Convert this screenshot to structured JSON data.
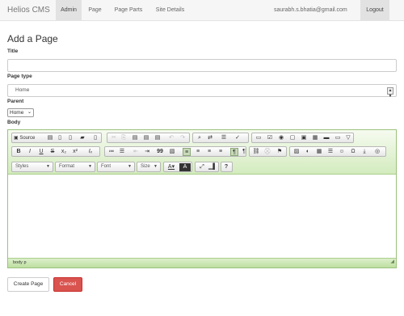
{
  "navbar": {
    "brand": "Helios CMS",
    "items": [
      {
        "label": "Admin",
        "active": true
      },
      {
        "label": "Page",
        "active": false
      },
      {
        "label": "Page Parts",
        "active": false
      },
      {
        "label": "Site Details",
        "active": false
      }
    ],
    "user_email": "saurabh.s.bhatia@gmail.com",
    "logout_label": "Logout"
  },
  "form": {
    "heading": "Add a Page",
    "title_label": "Title",
    "title_value": "",
    "page_type_label": "Page type",
    "page_type_value": "Home",
    "parent_label": "Parent",
    "parent_value": "Home",
    "body_label": "Body"
  },
  "editor": {
    "source_label": "Source",
    "toolbar_row1": [
      {
        "name": "save-icon",
        "glyph": "💾"
      },
      {
        "name": "new-page-icon",
        "glyph": "🗋"
      },
      {
        "name": "preview-icon",
        "glyph": "🗎"
      },
      {
        "name": "print-icon",
        "glyph": "🖶"
      },
      {
        "name": "templates-icon",
        "glyph": "🗐"
      },
      {
        "name": "cut-icon",
        "glyph": "✂"
      },
      {
        "name": "copy-icon",
        "glyph": "⎘"
      },
      {
        "name": "paste-icon",
        "glyph": "📋"
      },
      {
        "name": "paste-text-icon",
        "glyph": "📄"
      },
      {
        "name": "paste-word-icon",
        "glyph": "W"
      },
      {
        "name": "undo-icon",
        "glyph": "↶"
      },
      {
        "name": "redo-icon",
        "glyph": "↷"
      },
      {
        "name": "find-icon",
        "glyph": "🔍"
      },
      {
        "name": "replace-icon",
        "glyph": "⇄"
      },
      {
        "name": "select-all-icon",
        "glyph": "▤"
      },
      {
        "name": "spellcheck-icon",
        "glyph": "✓"
      },
      {
        "name": "form-icon",
        "glyph": "▭"
      },
      {
        "name": "checkbox-icon",
        "glyph": "☑"
      },
      {
        "name": "radio-icon",
        "glyph": "◉"
      },
      {
        "name": "textfield-icon",
        "glyph": "▢"
      },
      {
        "name": "textarea-icon",
        "glyph": "▣"
      },
      {
        "name": "select-field-icon",
        "glyph": "▦"
      },
      {
        "name": "button-field-icon",
        "glyph": "▬"
      },
      {
        "name": "image-button-icon",
        "glyph": "▭"
      },
      {
        "name": "hidden-field-icon",
        "glyph": "▽"
      }
    ],
    "toolbar_row2": [
      {
        "name": "bold-icon",
        "glyph": "B"
      },
      {
        "name": "italic-icon",
        "glyph": "I"
      },
      {
        "name": "underline-icon",
        "glyph": "U"
      },
      {
        "name": "strike-icon",
        "glyph": "S"
      },
      {
        "name": "subscript-icon",
        "glyph": "x₂"
      },
      {
        "name": "superscript-icon",
        "glyph": "x²"
      },
      {
        "name": "remove-format-icon",
        "glyph": "Ix"
      },
      {
        "name": "numbered-list-icon",
        "glyph": "≔"
      },
      {
        "name": "bulleted-list-icon",
        "glyph": "☰"
      },
      {
        "name": "outdent-icon",
        "glyph": "⇤"
      },
      {
        "name": "indent-icon",
        "glyph": "⇥"
      },
      {
        "name": "blockquote-icon",
        "glyph": "❞"
      },
      {
        "name": "div-icon",
        "glyph": "▧"
      },
      {
        "name": "align-left-icon",
        "glyph": "≡"
      },
      {
        "name": "align-center-icon",
        "glyph": "≡"
      },
      {
        "name": "align-right-icon",
        "glyph": "≡"
      },
      {
        "name": "justify-icon",
        "glyph": "≡"
      },
      {
        "name": "ltr-icon",
        "glyph": "¶"
      },
      {
        "name": "rtl-icon",
        "glyph": "¶"
      },
      {
        "name": "link-icon",
        "glyph": "⛓"
      },
      {
        "name": "unlink-icon",
        "glyph": "⛒"
      },
      {
        "name": "anchor-icon",
        "glyph": "⚑"
      },
      {
        "name": "image-icon",
        "glyph": "▨"
      },
      {
        "name": "flash-icon",
        "glyph": "◐"
      },
      {
        "name": "table-icon",
        "glyph": "▦"
      },
      {
        "name": "horizontal-rule-icon",
        "glyph": "―"
      },
      {
        "name": "smiley-icon",
        "glyph": "☺"
      },
      {
        "name": "special-char-icon",
        "glyph": "Ω"
      },
      {
        "name": "page-break-icon",
        "glyph": "⤓"
      },
      {
        "name": "iframe-icon",
        "glyph": "◎"
      }
    ],
    "styles_label": "Styles",
    "format_label": "Format",
    "font_label": "Font",
    "size_label": "Size",
    "status_path": "body  p"
  },
  "actions": {
    "create_label": "Create Page",
    "cancel_label": "Cancel"
  }
}
